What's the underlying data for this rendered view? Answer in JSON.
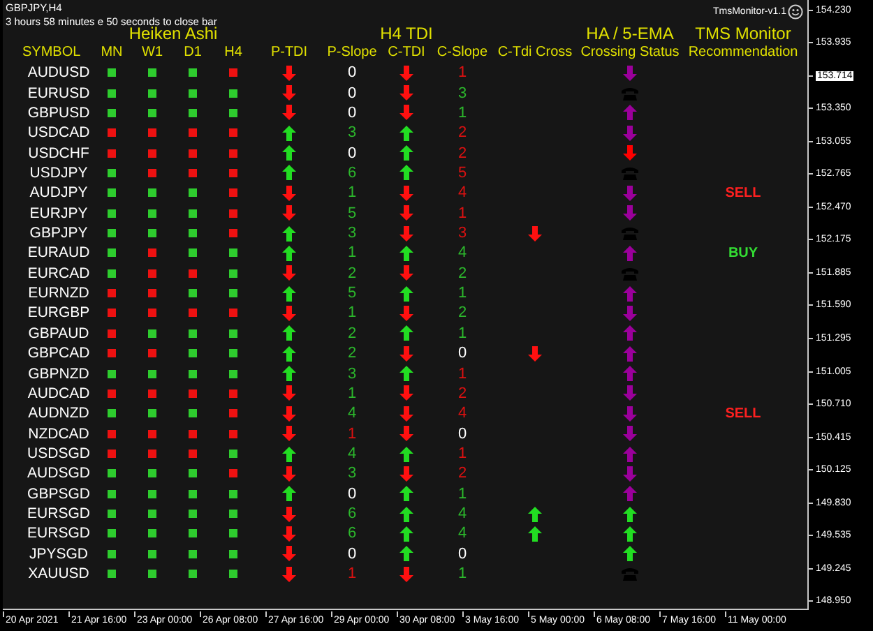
{
  "chart": {
    "symbol_timeframe": "GBPJPY,H4",
    "countdown": "3 hours 58 minutes e 50 seconds to close bar",
    "indicator_name": "TmsMonitor-v1.1"
  },
  "group_headers": [
    "Heiken Ashi",
    "H4 TDI",
    "HA / 5-EMA",
    "TMS Monitor"
  ],
  "columns": [
    "SYMBOL",
    "MN",
    "W1",
    "D1",
    "H4",
    "P-TDI",
    "P-Slope",
    "C-TDI",
    "C-Slope",
    "C-Tdi Cross",
    "Crossing Status",
    "Recommendation"
  ],
  "rows": [
    {
      "symbol": "AUDUSD",
      "ha_bullish": [
        true,
        true,
        true,
        false
      ],
      "p_tdi_up": false,
      "p_slope": {
        "value": "0",
        "color": "#ffffff"
      },
      "c_tdi_up": false,
      "c_slope": {
        "value": "1",
        "color": "#dd1111"
      },
      "status": {
        "kind": "down",
        "color": "#9b009b"
      }
    },
    {
      "symbol": "EURUSD",
      "ha_bullish": [
        true,
        true,
        true,
        true
      ],
      "p_tdi_up": false,
      "p_slope": {
        "value": "0",
        "color": "#ffffff"
      },
      "c_tdi_up": false,
      "c_slope": {
        "value": "3",
        "color": "#2cb82c"
      },
      "status": {
        "kind": "phone",
        "color": "#000000"
      }
    },
    {
      "symbol": "GBPUSD",
      "ha_bullish": [
        true,
        true,
        true,
        true
      ],
      "p_tdi_up": false,
      "p_slope": {
        "value": "0",
        "color": "#ffffff"
      },
      "c_tdi_up": false,
      "c_slope": {
        "value": "1",
        "color": "#2cb82c"
      },
      "status": {
        "kind": "up",
        "color": "#9b009b"
      }
    },
    {
      "symbol": "USDCAD",
      "ha_bullish": [
        false,
        false,
        false,
        false
      ],
      "p_tdi_up": true,
      "p_slope": {
        "value": "3",
        "color": "#2cb82c"
      },
      "c_tdi_up": true,
      "c_slope": {
        "value": "2",
        "color": "#dd1111"
      },
      "status": {
        "kind": "down",
        "color": "#9b009b"
      }
    },
    {
      "symbol": "USDCHF",
      "ha_bullish": [
        false,
        false,
        false,
        false
      ],
      "p_tdi_up": true,
      "p_slope": {
        "value": "0",
        "color": "#ffffff"
      },
      "c_tdi_up": true,
      "c_slope": {
        "value": "2",
        "color": "#dd1111"
      },
      "status": {
        "kind": "down",
        "color": "#ff0000"
      }
    },
    {
      "symbol": "USDJPY",
      "ha_bullish": [
        true,
        false,
        false,
        false
      ],
      "p_tdi_up": true,
      "p_slope": {
        "value": "6",
        "color": "#2cb82c"
      },
      "c_tdi_up": true,
      "c_slope": {
        "value": "5",
        "color": "#dd1111"
      },
      "status": {
        "kind": "phone",
        "color": "#000000"
      }
    },
    {
      "symbol": "AUDJPY",
      "ha_bullish": [
        true,
        true,
        true,
        false
      ],
      "p_tdi_up": false,
      "p_slope": {
        "value": "1",
        "color": "#2cb82c"
      },
      "c_tdi_up": false,
      "c_slope": {
        "value": "4",
        "color": "#dd1111"
      },
      "status": {
        "kind": "down",
        "color": "#9b009b"
      },
      "recommendation": {
        "text": "SELL",
        "kind": "sell"
      }
    },
    {
      "symbol": "EURJPY",
      "ha_bullish": [
        true,
        true,
        true,
        false
      ],
      "p_tdi_up": false,
      "p_slope": {
        "value": "5",
        "color": "#2cb82c"
      },
      "c_tdi_up": false,
      "c_slope": {
        "value": "1",
        "color": "#dd1111"
      },
      "status": {
        "kind": "down",
        "color": "#9b009b"
      }
    },
    {
      "symbol": "GBPJPY",
      "ha_bullish": [
        true,
        true,
        true,
        false
      ],
      "p_tdi_up": true,
      "p_slope": {
        "value": "3",
        "color": "#2cb82c"
      },
      "c_tdi_up": false,
      "c_slope": {
        "value": "3",
        "color": "#dd1111"
      },
      "cross": {
        "kind": "down"
      },
      "status": {
        "kind": "phone",
        "color": "#000000"
      }
    },
    {
      "symbol": "EURAUD",
      "ha_bullish": [
        true,
        false,
        true,
        true
      ],
      "p_tdi_up": true,
      "p_slope": {
        "value": "1",
        "color": "#2cb82c"
      },
      "c_tdi_up": true,
      "c_slope": {
        "value": "4",
        "color": "#2cb82c"
      },
      "status": {
        "kind": "up",
        "color": "#9b009b"
      },
      "recommendation": {
        "text": "BUY",
        "kind": "buy"
      }
    },
    {
      "symbol": "EURCAD",
      "ha_bullish": [
        true,
        false,
        false,
        true
      ],
      "p_tdi_up": false,
      "p_slope": {
        "value": "2",
        "color": "#2cb82c"
      },
      "c_tdi_up": false,
      "c_slope": {
        "value": "2",
        "color": "#2cb82c"
      },
      "status": {
        "kind": "phone",
        "color": "#000000"
      }
    },
    {
      "symbol": "EURNZD",
      "ha_bullish": [
        false,
        false,
        true,
        true
      ],
      "p_tdi_up": true,
      "p_slope": {
        "value": "5",
        "color": "#2cb82c"
      },
      "c_tdi_up": true,
      "c_slope": {
        "value": "1",
        "color": "#2cb82c"
      },
      "status": {
        "kind": "up",
        "color": "#9b009b"
      }
    },
    {
      "symbol": "EURGBP",
      "ha_bullish": [
        false,
        false,
        false,
        false
      ],
      "p_tdi_up": false,
      "p_slope": {
        "value": "1",
        "color": "#2cb82c"
      },
      "c_tdi_up": false,
      "c_slope": {
        "value": "2",
        "color": "#2cb82c"
      },
      "status": {
        "kind": "down",
        "color": "#9b009b"
      }
    },
    {
      "symbol": "GBPAUD",
      "ha_bullish": [
        false,
        true,
        true,
        true
      ],
      "p_tdi_up": true,
      "p_slope": {
        "value": "2",
        "color": "#2cb82c"
      },
      "c_tdi_up": true,
      "c_slope": {
        "value": "1",
        "color": "#2cb82c"
      },
      "status": {
        "kind": "up",
        "color": "#9b009b"
      }
    },
    {
      "symbol": "GBPCAD",
      "ha_bullish": [
        false,
        false,
        true,
        true
      ],
      "p_tdi_up": true,
      "p_slope": {
        "value": "2",
        "color": "#2cb82c"
      },
      "c_tdi_up": false,
      "c_slope": {
        "value": "0",
        "color": "#ffffff"
      },
      "cross": {
        "kind": "down"
      },
      "status": {
        "kind": "up",
        "color": "#9b009b"
      }
    },
    {
      "symbol": "GBPNZD",
      "ha_bullish": [
        true,
        true,
        true,
        true
      ],
      "p_tdi_up": true,
      "p_slope": {
        "value": "3",
        "color": "#2cb82c"
      },
      "c_tdi_up": true,
      "c_slope": {
        "value": "1",
        "color": "#dd1111"
      },
      "status": {
        "kind": "up",
        "color": "#9b009b"
      }
    },
    {
      "symbol": "AUDCAD",
      "ha_bullish": [
        false,
        false,
        false,
        false
      ],
      "p_tdi_up": false,
      "p_slope": {
        "value": "1",
        "color": "#2cb82c"
      },
      "c_tdi_up": false,
      "c_slope": {
        "value": "2",
        "color": "#dd1111"
      },
      "status": {
        "kind": "down",
        "color": "#9b009b"
      }
    },
    {
      "symbol": "AUDNZD",
      "ha_bullish": [
        true,
        true,
        true,
        false
      ],
      "p_tdi_up": false,
      "p_slope": {
        "value": "4",
        "color": "#2cb82c"
      },
      "c_tdi_up": false,
      "c_slope": {
        "value": "4",
        "color": "#dd1111"
      },
      "status": {
        "kind": "down",
        "color": "#9b009b"
      },
      "recommendation": {
        "text": "SELL",
        "kind": "sell"
      }
    },
    {
      "symbol": "NZDCAD",
      "ha_bullish": [
        false,
        false,
        false,
        false
      ],
      "p_tdi_up": false,
      "p_slope": {
        "value": "1",
        "color": "#dd1111"
      },
      "c_tdi_up": false,
      "c_slope": {
        "value": "0",
        "color": "#ffffff"
      },
      "status": {
        "kind": "down",
        "color": "#9b009b"
      }
    },
    {
      "symbol": "USDSGD",
      "ha_bullish": [
        false,
        false,
        false,
        true
      ],
      "p_tdi_up": true,
      "p_slope": {
        "value": "4",
        "color": "#2cb82c"
      },
      "c_tdi_up": true,
      "c_slope": {
        "value": "1",
        "color": "#dd1111"
      },
      "status": {
        "kind": "up",
        "color": "#9b009b"
      }
    },
    {
      "symbol": "AUDSGD",
      "ha_bullish": [
        true,
        true,
        true,
        false
      ],
      "p_tdi_up": false,
      "p_slope": {
        "value": "3",
        "color": "#2cb82c"
      },
      "c_tdi_up": false,
      "c_slope": {
        "value": "2",
        "color": "#dd1111"
      },
      "status": {
        "kind": "down",
        "color": "#9b009b"
      }
    },
    {
      "symbol": "GBPSGD",
      "ha_bullish": [
        true,
        true,
        true,
        true
      ],
      "p_tdi_up": true,
      "p_slope": {
        "value": "0",
        "color": "#ffffff"
      },
      "c_tdi_up": true,
      "c_slope": {
        "value": "1",
        "color": "#2cb82c"
      },
      "status": {
        "kind": "up",
        "color": "#9b009b"
      }
    },
    {
      "symbol": "EURSGD",
      "ha_bullish": [
        true,
        true,
        true,
        true
      ],
      "p_tdi_up": false,
      "p_slope": {
        "value": "6",
        "color": "#2cb82c"
      },
      "c_tdi_up": true,
      "c_slope": {
        "value": "4",
        "color": "#2cb82c"
      },
      "cross": {
        "kind": "up"
      },
      "status": {
        "kind": "up",
        "color": "#22dd22"
      }
    },
    {
      "symbol": "EURSGD",
      "ha_bullish": [
        true,
        true,
        true,
        true
      ],
      "p_tdi_up": false,
      "p_slope": {
        "value": "6",
        "color": "#2cb82c"
      },
      "c_tdi_up": true,
      "c_slope": {
        "value": "4",
        "color": "#2cb82c"
      },
      "cross": {
        "kind": "up"
      },
      "status": {
        "kind": "up",
        "color": "#22dd22"
      }
    },
    {
      "symbol": "JPYSGD",
      "ha_bullish": [
        true,
        true,
        true,
        true
      ],
      "p_tdi_up": false,
      "p_slope": {
        "value": "0",
        "color": "#ffffff"
      },
      "c_tdi_up": true,
      "c_slope": {
        "value": "0",
        "color": "#ffffff"
      },
      "status": {
        "kind": "up",
        "color": "#22dd22"
      }
    },
    {
      "symbol": "XAUUSD",
      "ha_bullish": [
        true,
        true,
        true,
        true
      ],
      "p_tdi_up": false,
      "p_slope": {
        "value": "1",
        "color": "#dd1111"
      },
      "c_tdi_up": false,
      "c_slope": {
        "value": "1",
        "color": "#2cb82c"
      },
      "status": {
        "kind": "phone",
        "color": "#000000"
      }
    }
  ],
  "price_axis": [
    {
      "text": "154.230",
      "kind": "tick"
    },
    {
      "text": "153.935",
      "kind": "tick"
    },
    {
      "text": "153.714",
      "kind": "current"
    },
    {
      "text": "153.350",
      "kind": "tick"
    },
    {
      "text": "153.055",
      "kind": "tick"
    },
    {
      "text": "152.765",
      "kind": "tick"
    },
    {
      "text": "152.470",
      "kind": "tick"
    },
    {
      "text": "152.175",
      "kind": "tick"
    },
    {
      "text": "151.885",
      "kind": "tick"
    },
    {
      "text": "151.590",
      "kind": "tick"
    },
    {
      "text": "151.295",
      "kind": "tick"
    },
    {
      "text": "151.005",
      "kind": "tick"
    },
    {
      "text": "150.710",
      "kind": "tick"
    },
    {
      "text": "150.415",
      "kind": "tick"
    },
    {
      "text": "150.125",
      "kind": "tick"
    },
    {
      "text": "149.830",
      "kind": "tick"
    },
    {
      "text": "149.535",
      "kind": "tick"
    },
    {
      "text": "149.245",
      "kind": "tick"
    },
    {
      "text": "148.950",
      "kind": "tick"
    }
  ],
  "time_axis": [
    "20 Apr 2021",
    "21 Apr 16:00",
    "23 Apr 00:00",
    "26 Apr 08:00",
    "27 Apr 16:00",
    "29 Apr 00:00",
    "30 Apr 08:00",
    "3 May 16:00",
    "5 May 00:00",
    "6 May 08:00",
    "7 May 16:00",
    "11 May 00:00"
  ]
}
